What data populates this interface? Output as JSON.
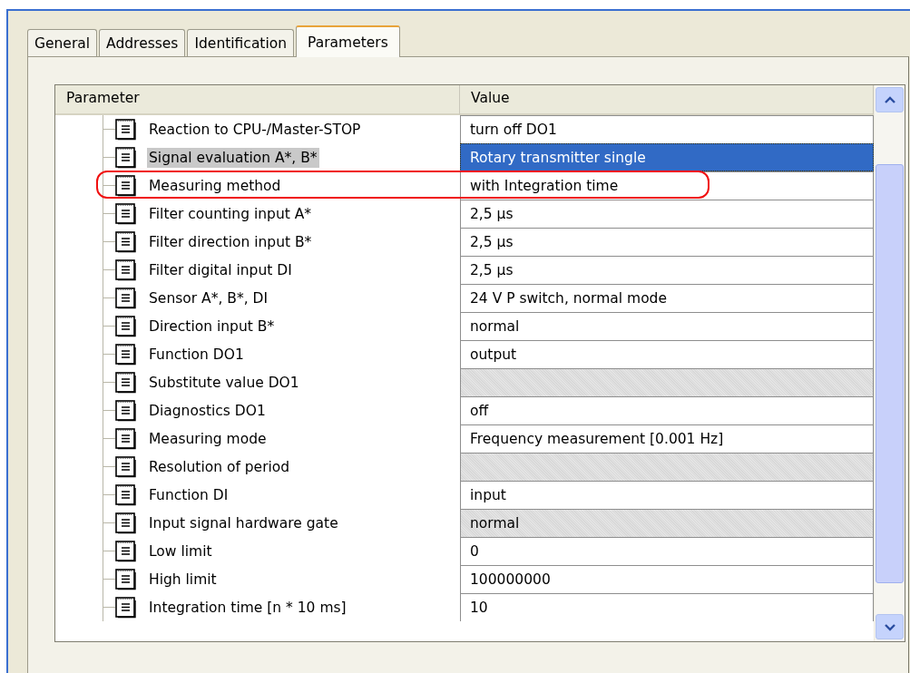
{
  "tabs": [
    {
      "label": "General",
      "selected": false
    },
    {
      "label": "Addresses",
      "selected": false
    },
    {
      "label": "Identification",
      "selected": false
    },
    {
      "label": "Parameters",
      "selected": true
    }
  ],
  "table": {
    "columns": [
      "Parameter",
      "Value"
    ],
    "rows": [
      {
        "name": "Reaction to CPU-/Master-STOP",
        "value": "turn off DO1",
        "selected": false,
        "disabled": false,
        "highlighted": false
      },
      {
        "name": "Signal evaluation A*, B*",
        "value": "Rotary transmitter single",
        "selected": true,
        "disabled": false,
        "highlighted": false
      },
      {
        "name": "Measuring method",
        "value": "with Integration time",
        "selected": false,
        "disabled": false,
        "highlighted": true
      },
      {
        "name": "Filter counting input A*",
        "value": "2,5 µs",
        "selected": false,
        "disabled": false,
        "highlighted": false
      },
      {
        "name": "Filter direction input B*",
        "value": "2,5 µs",
        "selected": false,
        "disabled": false,
        "highlighted": false
      },
      {
        "name": "Filter digital input DI",
        "value": "2,5 µs",
        "selected": false,
        "disabled": false,
        "highlighted": false
      },
      {
        "name": "Sensor A*, B*, DI",
        "value": "24 V P switch, normal mode",
        "selected": false,
        "disabled": false,
        "highlighted": false
      },
      {
        "name": "Direction input B*",
        "value": "normal",
        "selected": false,
        "disabled": false,
        "highlighted": false
      },
      {
        "name": "Function DO1",
        "value": "output",
        "selected": false,
        "disabled": false,
        "highlighted": false
      },
      {
        "name": "Substitute value DO1",
        "selected": false,
        "disabled": true,
        "highlighted": false
      },
      {
        "name": "Diagnostics DO1",
        "value": "off",
        "selected": false,
        "disabled": false,
        "highlighted": false
      },
      {
        "name": "Measuring mode",
        "value": "Frequency measurement [0.001 Hz]",
        "selected": false,
        "disabled": false,
        "highlighted": false
      },
      {
        "name": "Resolution of period",
        "selected": false,
        "disabled": true,
        "highlighted": false
      },
      {
        "name": "Function DI",
        "value": "input",
        "selected": false,
        "disabled": false,
        "highlighted": false
      },
      {
        "name": "Input signal hardware gate",
        "value": "normal",
        "selected": false,
        "disabled": true,
        "highlighted": false
      },
      {
        "name": "Low limit",
        "value": "0",
        "selected": false,
        "disabled": false,
        "highlighted": false
      },
      {
        "name": "High limit",
        "value": "100000000",
        "selected": false,
        "disabled": false,
        "highlighted": false
      },
      {
        "name": "Integration time [n * 10 ms]",
        "value": "10",
        "selected": false,
        "disabled": false,
        "highlighted": false
      }
    ]
  }
}
